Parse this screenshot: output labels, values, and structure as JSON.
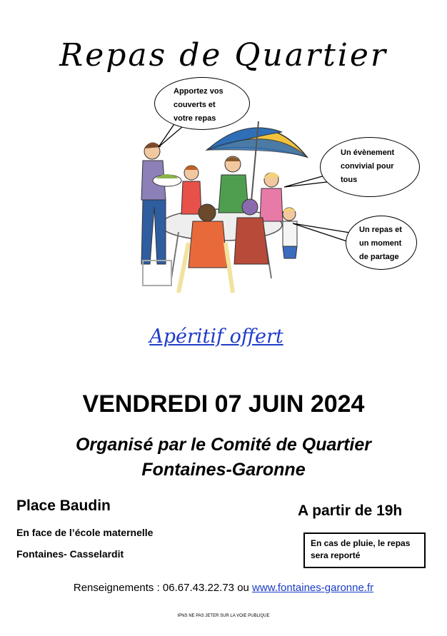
{
  "title": "Repas de Quartier",
  "bubbles": {
    "b1": [
      "Apportez vos",
      "couverts et",
      "votre repas"
    ],
    "b2": [
      "Un évènement",
      "convivial pour",
      "tous"
    ],
    "b3": [
      "Un repas et",
      "un moment",
      "de partage"
    ]
  },
  "illustration": {
    "name": "people-eating-outdoors-illustration",
    "umbrella_colors": [
      "#2e6fb8",
      "#f3c23c"
    ]
  },
  "aperitif": "Apéritif offert",
  "date": "VENDREDI 07 JUIN 2024",
  "organizer": {
    "line1": "Organisé par le Comité de Quartier",
    "line2": "Fontaines-Garonne"
  },
  "location": {
    "place": "Place Baudin",
    "detail1": "En face de l’école maternelle",
    "detail2": "Fontaines- Casselardit"
  },
  "time": "A partir de 19h",
  "rain_notice": [
    "En cas de pluie, le repas",
    "sera reporté"
  ],
  "contact": {
    "label": "Renseignements : 06.67.43.22.73 ou ",
    "website": "www.fontaines-garonne.fr"
  },
  "footer": "IPNS NE PAS JETER SUR LA VOIE PUBLIQUE",
  "colors": {
    "link": "#1a3cc4",
    "aperitif": "#1f3cc8"
  }
}
